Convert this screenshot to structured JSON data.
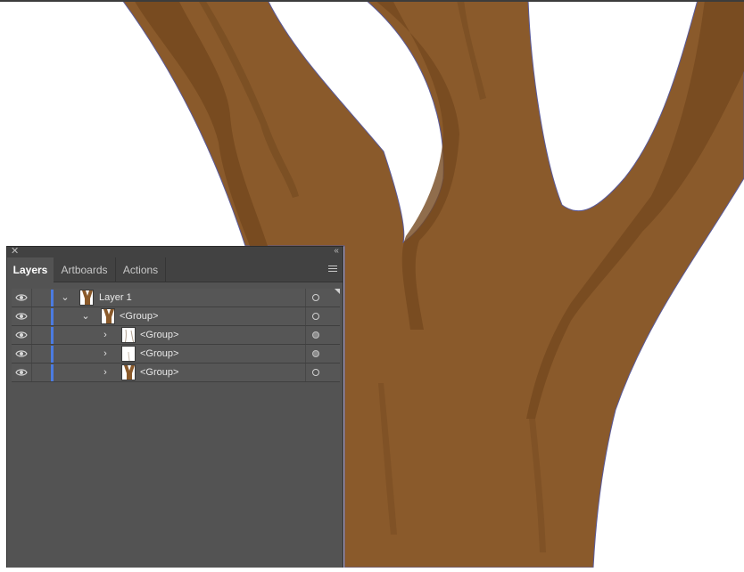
{
  "panel": {
    "close_icon": "close-icon",
    "collapse_icon": "collapse-icon",
    "tabs": [
      {
        "label": "Layers",
        "active": true
      },
      {
        "label": "Artboards",
        "active": false
      },
      {
        "label": "Actions",
        "active": false
      }
    ],
    "menu_icon": "panel-menu-icon",
    "layer_color": "#4b7be0",
    "rows": [
      {
        "label": "Layer 1",
        "expanded": true,
        "visible": true,
        "targeted": false
      },
      {
        "label": "<Group>",
        "expanded": true,
        "visible": true,
        "targeted": false
      },
      {
        "label": "<Group>",
        "expanded": false,
        "visible": true,
        "targeted": true
      },
      {
        "label": "<Group>",
        "expanded": false,
        "visible": true,
        "targeted": true
      },
      {
        "label": "<Group>",
        "expanded": false,
        "visible": true,
        "targeted": false
      }
    ]
  },
  "artwork": {
    "trunk_color": "#8a5a2b",
    "shadow_color": "#6e461e",
    "outline_color": "#5a5a9a"
  }
}
